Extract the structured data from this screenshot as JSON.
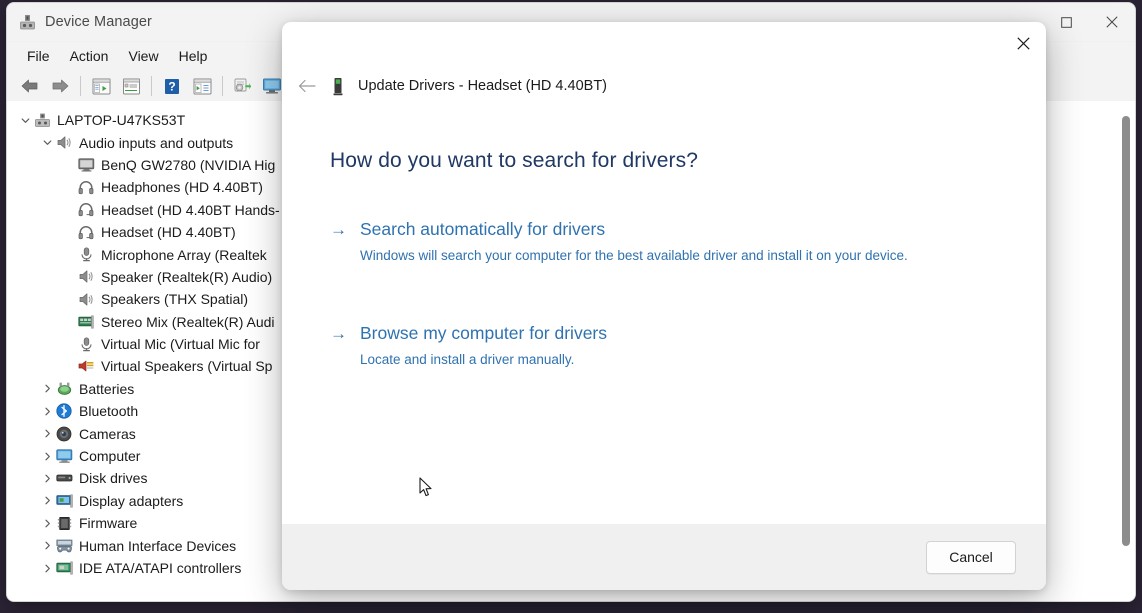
{
  "window": {
    "title": "Device Manager",
    "icon": "device-manager-icon",
    "controls": [
      {
        "name": "minimize",
        "glyph": "minimize-icon"
      },
      {
        "name": "maximize",
        "glyph": "maximize-icon"
      },
      {
        "name": "close",
        "glyph": "close-icon"
      }
    ]
  },
  "menu": {
    "items": [
      {
        "label": "File"
      },
      {
        "label": "Action"
      },
      {
        "label": "View"
      },
      {
        "label": "Help"
      }
    ]
  },
  "toolbar": {
    "buttons": [
      {
        "name": "back-button",
        "icon": "back-arrow-icon"
      },
      {
        "name": "forward-button",
        "icon": "forward-arrow-icon"
      },
      {
        "name": "separator-1",
        "icon": "separator"
      },
      {
        "name": "show-hide-console-tree-button",
        "icon": "console-tree-icon"
      },
      {
        "name": "properties-button",
        "icon": "properties-icon"
      },
      {
        "name": "separator-2",
        "icon": "separator"
      },
      {
        "name": "help-button",
        "icon": "help-question-icon"
      },
      {
        "name": "scan-for-hardware-changes-button",
        "icon": "scan-hardware-icon"
      },
      {
        "name": "separator-3",
        "icon": "separator"
      },
      {
        "name": "update-driver-button",
        "icon": "update-driver-icon"
      },
      {
        "name": "display-button",
        "icon": "display-icon"
      }
    ]
  },
  "tree": {
    "nodes": [
      {
        "label": "LAPTOP-U47KS53T",
        "indent": 0,
        "chevron": "expanded",
        "icon": "computer-node-icon"
      },
      {
        "label": "Audio inputs and outputs",
        "indent": 1,
        "chevron": "expanded",
        "icon": "speaker-icon"
      },
      {
        "label": "BenQ GW2780 (NVIDIA Hig",
        "indent": 2,
        "chevron": "none",
        "icon": "monitor-icon"
      },
      {
        "label": "Headphones (HD 4.40BT)",
        "indent": 2,
        "chevron": "none",
        "icon": "headphones-icon"
      },
      {
        "label": "Headset (HD 4.40BT Hands-",
        "indent": 2,
        "chevron": "none",
        "icon": "headset-icon"
      },
      {
        "label": "Headset (HD 4.40BT)",
        "indent": 2,
        "chevron": "none",
        "icon": "headset-icon"
      },
      {
        "label": "Microphone Array (Realtek",
        "indent": 2,
        "chevron": "none",
        "icon": "microphone-icon"
      },
      {
        "label": "Speaker (Realtek(R) Audio)",
        "indent": 2,
        "chevron": "none",
        "icon": "speaker-icon"
      },
      {
        "label": "Speakers (THX Spatial)",
        "indent": 2,
        "chevron": "none",
        "icon": "speaker-icon"
      },
      {
        "label": "Stereo Mix (Realtek(R) Audi",
        "indent": 2,
        "chevron": "none",
        "icon": "audio-card-icon"
      },
      {
        "label": "Virtual Mic (Virtual Mic for",
        "indent": 2,
        "chevron": "none",
        "icon": "microphone-icon"
      },
      {
        "label": "Virtual Speakers (Virtual Sp",
        "indent": 2,
        "chevron": "none",
        "icon": "virtual-speakers-icon"
      },
      {
        "label": "Batteries",
        "indent": 1,
        "chevron": "collapsed",
        "icon": "battery-icon"
      },
      {
        "label": "Bluetooth",
        "indent": 1,
        "chevron": "collapsed",
        "icon": "bluetooth-icon"
      },
      {
        "label": "Cameras",
        "indent": 1,
        "chevron": "collapsed",
        "icon": "camera-icon"
      },
      {
        "label": "Computer",
        "indent": 1,
        "chevron": "collapsed",
        "icon": "computer-icon"
      },
      {
        "label": "Disk drives",
        "indent": 1,
        "chevron": "collapsed",
        "icon": "disk-drive-icon"
      },
      {
        "label": "Display adapters",
        "indent": 1,
        "chevron": "collapsed",
        "icon": "display-adapter-icon"
      },
      {
        "label": "Firmware",
        "indent": 1,
        "chevron": "collapsed",
        "icon": "firmware-chip-icon"
      },
      {
        "label": "Human Interface Devices",
        "indent": 1,
        "chevron": "collapsed",
        "icon": "hid-gamepad-icon"
      },
      {
        "label": "IDE ATA/ATAPI controllers",
        "indent": 1,
        "chevron": "collapsed",
        "icon": "ide-controller-icon"
      }
    ]
  },
  "dialog": {
    "close_label": "close-icon",
    "back_label": "back-arrow-icon",
    "header_icon": "device-green-icon",
    "header_title": "Update Drivers - Headset (HD 4.40BT)",
    "heading": "How do you want to search for drivers?",
    "options": [
      {
        "arrow": "→",
        "title": "Search automatically for drivers",
        "description": "Windows will search your computer for the best available driver and install it on your device."
      },
      {
        "arrow": "→",
        "title": "Browse my computer for drivers",
        "description": "Locate and install a driver manually."
      }
    ],
    "cancel_label": "Cancel"
  },
  "colors": {
    "heading": "#1f3864",
    "link": "#2f72b0",
    "window_chrome": "#f3f3f3",
    "footer": "#f0f0f0",
    "desktop": "#2b2436"
  }
}
